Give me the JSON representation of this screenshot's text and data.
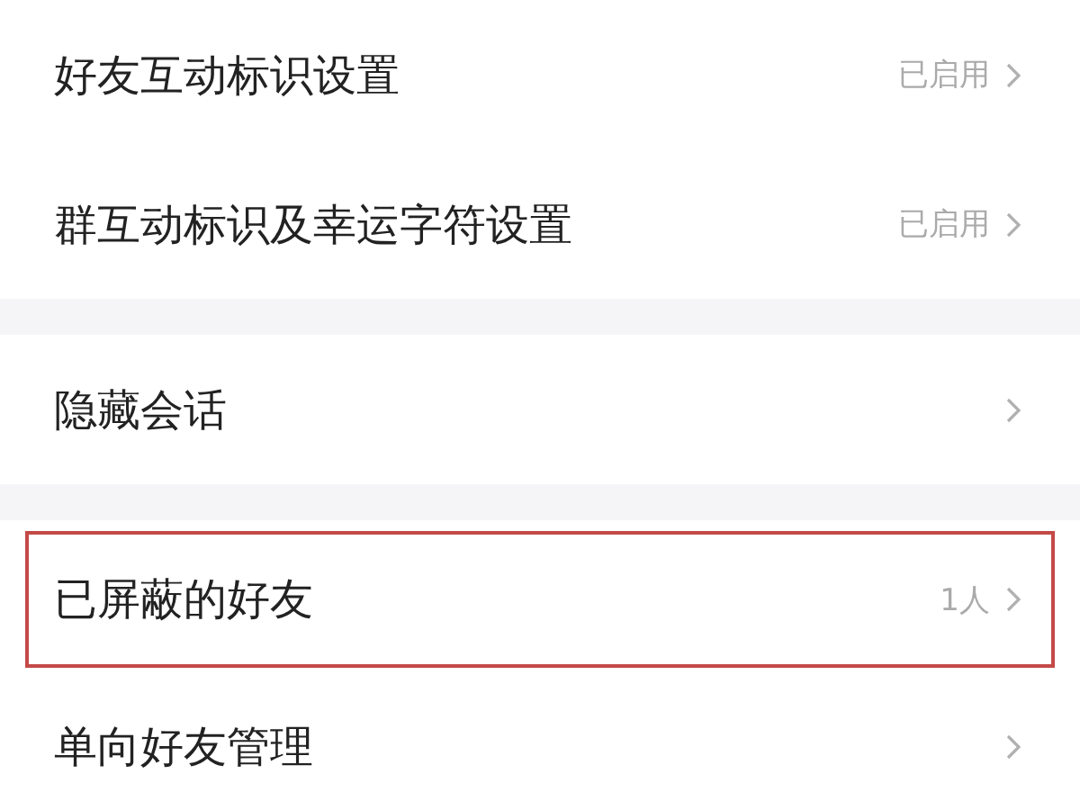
{
  "sections": [
    {
      "rows": [
        {
          "label": "好友互动标识设置",
          "value": "已启用",
          "highlighted": false
        },
        {
          "label": "群互动标识及幸运字符设置",
          "value": "已启用",
          "highlighted": false
        }
      ]
    },
    {
      "rows": [
        {
          "label": "隐藏会话",
          "highlighted": false
        }
      ]
    },
    {
      "rows": [
        {
          "label": "已屏蔽的好友",
          "value": "1人",
          "highlighted": true
        },
        {
          "label": "单向好友管理",
          "highlighted": false
        }
      ]
    }
  ]
}
